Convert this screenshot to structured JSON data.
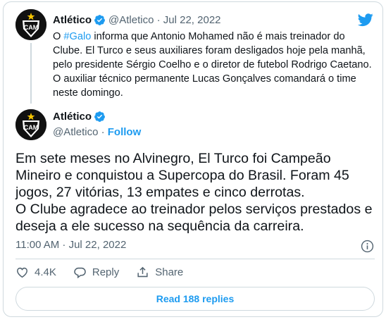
{
  "parent_tweet": {
    "name": "Atlético",
    "handle": "@Atletico",
    "separator": " · ",
    "date": "Jul 22, 2022",
    "text_before_hashtag": "O ",
    "hashtag": "#Galo",
    "text_after_hashtag": " informa que Antonio Mohamed não é mais treinador do Clube. El Turco e seus auxiliares foram desligados hoje pela manhã, pelo presidente Sérgio Coelho e o diretor de futebol Rodrigo Caetano. O auxiliar técnico permanente Lucas Gonçalves comandará o time neste domingo."
  },
  "main_tweet": {
    "name": "Atlético",
    "handle": "@Atletico",
    "separator": " · ",
    "follow_label": "Follow",
    "text": "Em sete meses no Alvinegro, El Turco foi Campeão Mineiro e conquistou a Supercopa do Brasil. Foram 45 jogos, 27 vitórias, 13 empates e cinco derrotas.\nO Clube agradece ao treinador pelos serviços prestados e deseja a ele sucesso na sequência da carreira.",
    "timestamp": "11:00 AM · Jul 22, 2022"
  },
  "actions": {
    "like_count": "4.4K",
    "reply_label": "Reply",
    "share_label": "Share"
  },
  "read_replies_label": "Read 188 replies",
  "colors": {
    "accent": "#1d9bf0",
    "text": "#0f1419",
    "muted": "#536471",
    "border": "#cfd9de"
  },
  "icons": [
    "twitter-bird-icon",
    "verified-badge-icon",
    "info-icon",
    "heart-icon",
    "reply-icon",
    "share-icon",
    "atletico-crest-logo"
  ]
}
